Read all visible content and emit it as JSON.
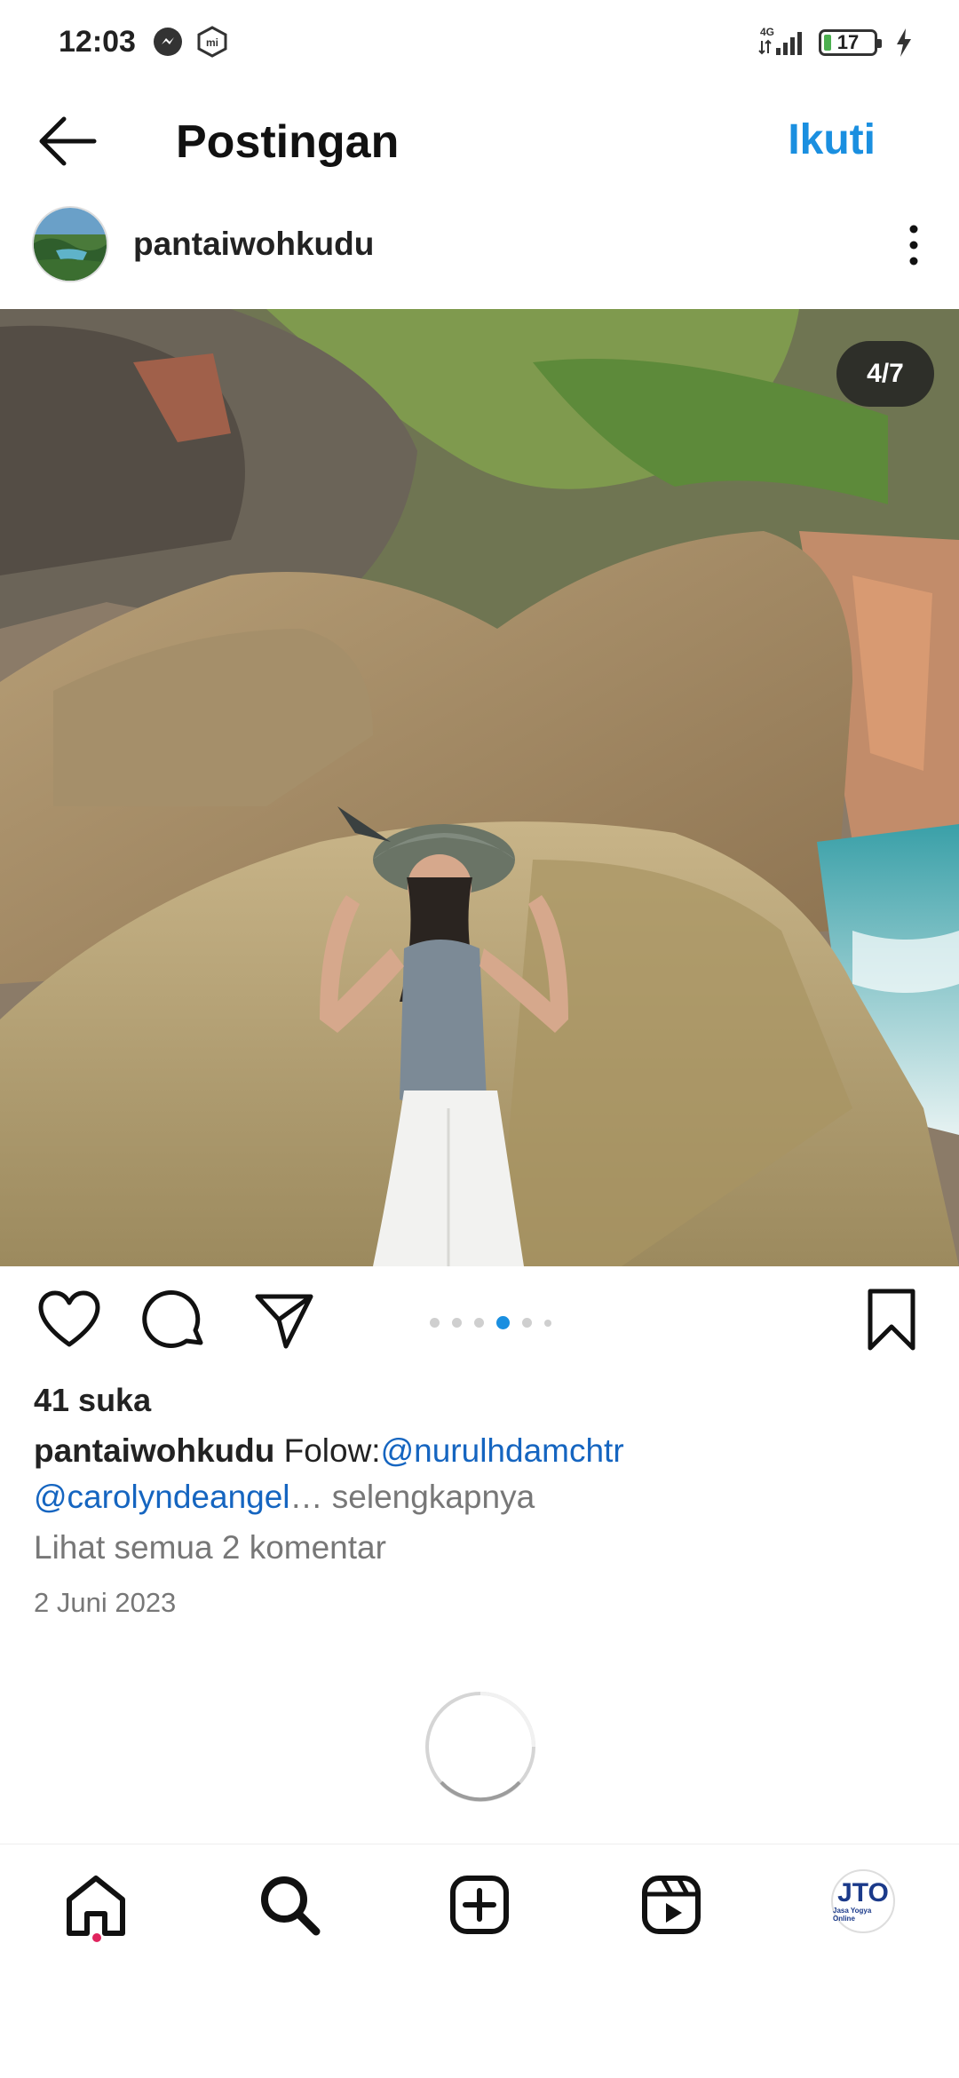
{
  "status_bar": {
    "time": "12:03",
    "network": "4G",
    "battery": "17"
  },
  "header": {
    "title": "Postingan",
    "follow_label": "Ikuti"
  },
  "post": {
    "username": "pantaiwohkudu",
    "image_counter": "4/7",
    "likes": "41 suka",
    "caption": {
      "user": "pantaiwohkudu",
      "text": " Folow:",
      "mention1": "@nurulhdamchtr",
      "mention2": "@carolyndeangel",
      "ellipsis": "…",
      "more": " selengkapnya"
    },
    "comments_link": "Lihat semua 2 komentar",
    "date": "2 Juni 2023",
    "carousel_index": 4,
    "carousel_total": 7
  },
  "profile_badge": {
    "logo": "JTO",
    "subtitle": "Jasa Yogya Online"
  },
  "colors": {
    "accent": "#1a8fe0",
    "mention": "#1565c0",
    "notification": "#e0245e"
  }
}
